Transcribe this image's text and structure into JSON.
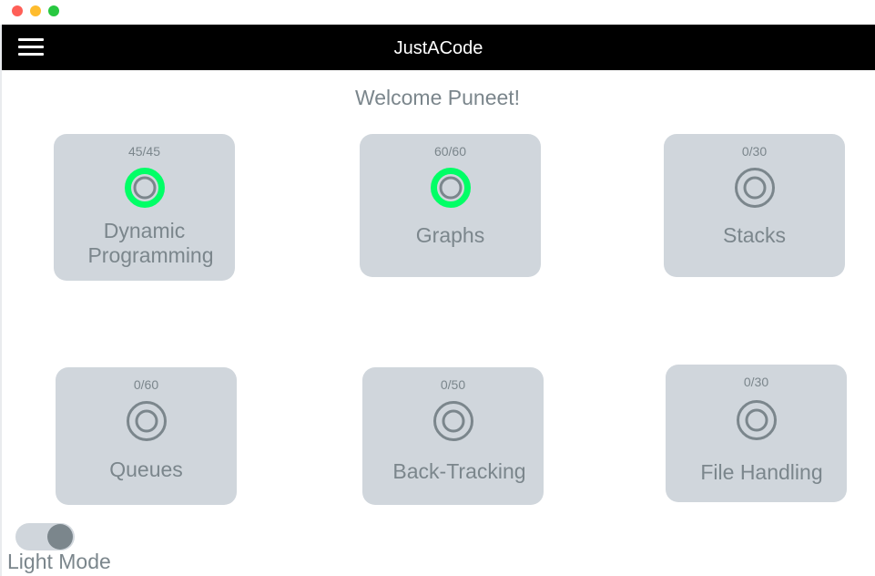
{
  "app": {
    "title": "JustACode",
    "welcome": "Welcome Puneet!"
  },
  "colors": {
    "appbar": "#000000",
    "card": "#d0d6dc",
    "text_muted": "#7b868c",
    "complete_ring": "#00ff66",
    "incomplete_ring": "#7b868c"
  },
  "topics": [
    {
      "name": "Dynamic Programming",
      "line1": "Dynamic",
      "line2": "Programming",
      "progress": "45/45",
      "complete": true
    },
    {
      "name": "Graphs",
      "progress": "60/60",
      "complete": true
    },
    {
      "name": "Stacks",
      "progress": "0/30",
      "complete": false
    },
    {
      "name": "Queues",
      "progress": "0/60",
      "complete": false
    },
    {
      "name": "Back-Tracking",
      "progress": "0/50",
      "complete": false
    },
    {
      "name": "File Handling",
      "progress": "0/30",
      "complete": false
    }
  ],
  "theme_toggle": {
    "label": "Light Mode",
    "on": true
  }
}
